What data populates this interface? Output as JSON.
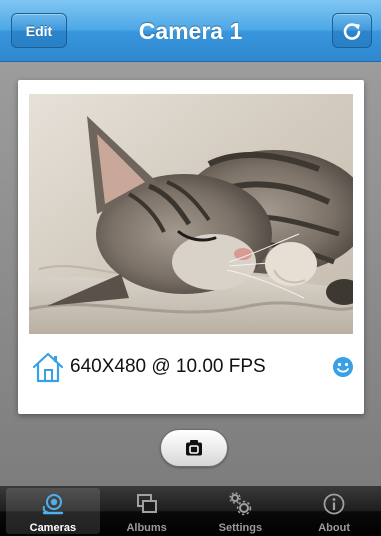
{
  "nav": {
    "title": "Camera 1",
    "edit_label": "Edit",
    "refresh_icon": "refresh-icon"
  },
  "camera": {
    "resolution_fps": "640X480 @ 10.00 FPS",
    "location_icon": "home-icon",
    "status_icon": "smiley-icon"
  },
  "snapshot": {
    "icon": "camera-icon"
  },
  "tabs": [
    {
      "label": "Cameras",
      "icon": "camera-eye-icon",
      "active": true
    },
    {
      "label": "Albums",
      "icon": "albums-icon",
      "active": false
    },
    {
      "label": "Settings",
      "icon": "gears-icon",
      "active": false
    },
    {
      "label": "About",
      "icon": "info-icon",
      "active": false
    }
  ],
  "colors": {
    "nav_blue": "#3896dc",
    "accent_blue": "#3aa0e6",
    "tabbar_black": "#000000"
  }
}
